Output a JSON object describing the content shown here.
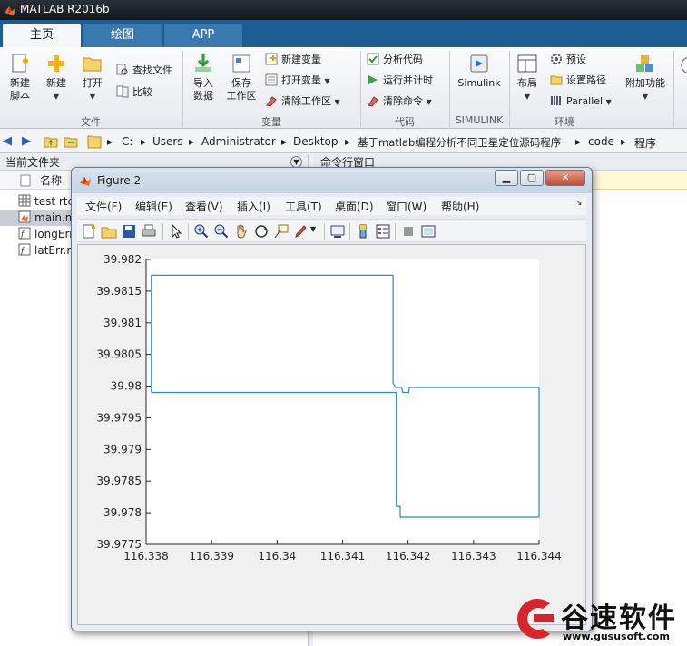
{
  "app": {
    "title": "MATLAB R2016b"
  },
  "tabs": [
    {
      "label": "主页",
      "active": true
    },
    {
      "label": "绘图",
      "active": false
    },
    {
      "label": "APP",
      "active": false
    }
  ],
  "ribbon": {
    "file": {
      "new_script": "新建\n脚本",
      "new": "新建",
      "open": "打开",
      "find_files": "查找文件",
      "compare": "比较",
      "group": "文件"
    },
    "variable": {
      "import": "导入\n数据",
      "save_ws": "保存\n工作区",
      "new_var": "新建变量",
      "open_var": "打开变量",
      "clear_ws": "清除工作区",
      "group": "变量"
    },
    "code": {
      "analyze": "分析代码",
      "run_time": "运行并计时",
      "clear_cmd": "清除命令",
      "group": "代码"
    },
    "simulink": {
      "label": "Simulink",
      "group": "SIMULINK"
    },
    "env": {
      "layout": "布局",
      "prefs": "预设",
      "set_path": "设置路径",
      "parallel": "Parallel",
      "addons": "附加功能",
      "group": "环境"
    }
  },
  "address": {
    "crumbs": [
      "C:",
      "Users",
      "Administrator",
      "Desktop",
      "基于matlab编程分析不同卫星定位源码程序",
      "code",
      "程序"
    ]
  },
  "current_folder": {
    "title": "当前文件夹",
    "col_name": "名称",
    "files": [
      {
        "name": "test rtc",
        "selected": false,
        "type": "table"
      },
      {
        "name": "main.m",
        "selected": true,
        "type": "script"
      },
      {
        "name": "longErr.m",
        "selected": false,
        "type": "function"
      },
      {
        "name": "latErr.m",
        "selected": false,
        "type": "function"
      }
    ]
  },
  "command_window": {
    "title": "命令行窗口"
  },
  "figure": {
    "title": "Figure 2",
    "menu": [
      "文件(F)",
      "编辑(E)",
      "查看(V)",
      "插入(I)",
      "工具(T)",
      "桌面(D)",
      "窗口(W)",
      "帮助(H)"
    ]
  },
  "chart_data": {
    "type": "line",
    "title": "",
    "xlabel": "",
    "ylabel": "",
    "xlim": [
      116.338,
      116.344
    ],
    "ylim": [
      39.9775,
      39.982
    ],
    "x_ticks": [
      "116.338",
      "116.339",
      "116.34",
      "116.341",
      "116.342",
      "116.343",
      "116.344"
    ],
    "y_ticks": [
      "39.982",
      "39.9815",
      "39.981",
      "39.9805",
      "39.98",
      "39.9795",
      "39.979",
      "39.9785",
      "39.978",
      "39.9775"
    ],
    "series": [
      {
        "color": "#2b8ac8",
        "x": [
          116.33808,
          116.33808,
          116.34177,
          116.34177,
          116.34181,
          116.3419,
          116.34192,
          116.34201,
          116.34202,
          116.3426,
          116.344,
          116.344,
          116.34188,
          116.34188,
          116.34182,
          116.34182,
          116.33808
        ],
        "y": [
          39.9799,
          39.98175,
          39.98175,
          39.98005,
          39.97998,
          39.97998,
          39.9799,
          39.9799,
          39.97998,
          39.97998,
          39.97998,
          39.97793,
          39.97793,
          39.9781,
          39.9781,
          39.9799,
          39.9799
        ]
      }
    ]
  },
  "watermark": {
    "text": "谷速软件",
    "url": "www.gususoft.com"
  }
}
